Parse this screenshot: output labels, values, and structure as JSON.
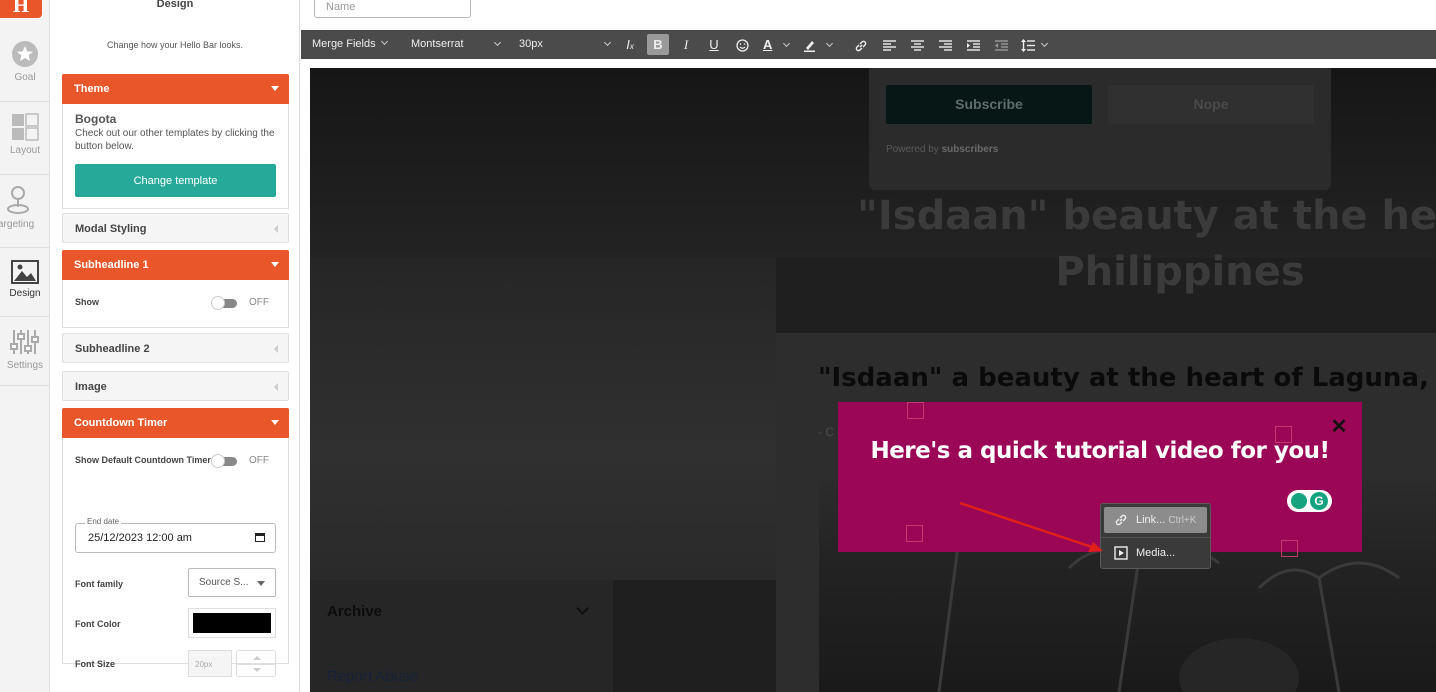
{
  "app": {
    "logo_letter": "H"
  },
  "rail": {
    "items": [
      {
        "label": "Goal",
        "icon": "star-icon"
      },
      {
        "label": "Layout",
        "icon": "layout-icon"
      },
      {
        "label": "argeting",
        "icon": "pin-icon"
      },
      {
        "label": "Design",
        "icon": "image-icon"
      },
      {
        "label": "Settings",
        "icon": "sliders-icon"
      }
    ]
  },
  "panel": {
    "title": "Design",
    "description": "Change how your Hello Bar looks.",
    "theme": {
      "header": "Theme",
      "name": "Bogota",
      "description": "Check out our other templates by clicking the button below.",
      "button": "Change template"
    },
    "modal_styling": "Modal Styling",
    "subheadline1": {
      "header": "Subheadline 1",
      "show_label": "Show",
      "toggle": "OFF"
    },
    "subheadline2": "Subheadline 2",
    "image": "Image",
    "countdown": {
      "header": "Countdown Timer",
      "show_default_label": "Show Default Countdown Timer",
      "toggle": "OFF",
      "end_date_label": "End date",
      "end_date_value": "25/12/2023 12:00 am",
      "font_family_label": "Font family",
      "font_family_value": "Source S...",
      "font_color_label": "Font Color",
      "font_color_value": "#000000",
      "font_size_label": "Font Size",
      "font_size_placeholder": "20px"
    }
  },
  "name_input": {
    "placeholder": "Name"
  },
  "toolbar": {
    "merge_fields": "Merge Fields",
    "font": "Montserrat",
    "size": "30px",
    "bold_active": true
  },
  "preview": {
    "subscribe": "Subscribe",
    "nope": "Nope",
    "powered_by": "Powered by",
    "powered_brand": "subscribers",
    "background_headline": "\"Isdaan\" beauty at the heart Philippines",
    "article_title": "\"Isdaan\" a beauty at the heart of Laguna, Ph",
    "article_meta": "- C",
    "archive": "Archive",
    "report_abuse": "Report Abuse"
  },
  "tutorial": {
    "text": "Here's a quick tutorial video for you!",
    "background": "#9b0756"
  },
  "context_menu": {
    "items": [
      {
        "label": "Link...",
        "shortcut": "Ctrl+K",
        "icon": "link-icon"
      },
      {
        "label": "Media...",
        "shortcut": "",
        "icon": "media-icon"
      }
    ]
  },
  "colors": {
    "accent": "#e8562a",
    "teal": "#27a99a",
    "toolbar": "#4b4b4b"
  }
}
